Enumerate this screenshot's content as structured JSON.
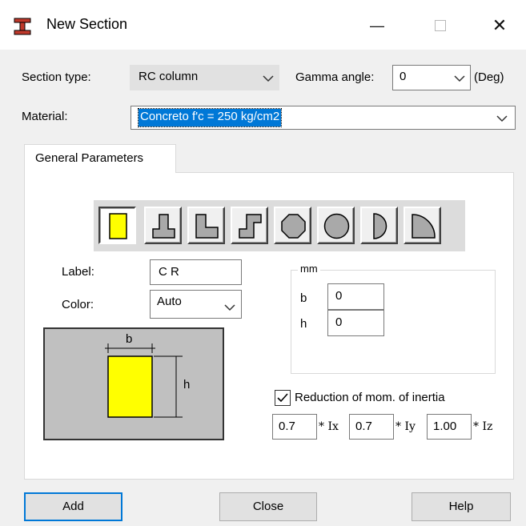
{
  "window": {
    "title": "New Section",
    "icon": "section-i-beam-icon",
    "minimize_glyph": "—",
    "close_glyph": "✕"
  },
  "section_type": {
    "label": "Section type:",
    "value": "RC column"
  },
  "gamma": {
    "label": "Gamma angle:",
    "value": "0",
    "unit": "(Deg)"
  },
  "material": {
    "label": "Material:",
    "value": "Concreto f'c = 250 kg/cm2"
  },
  "tabs": [
    {
      "label": "General Parameters"
    }
  ],
  "shapes": [
    {
      "icon": "rectangle-shape-icon",
      "selected": true
    },
    {
      "icon": "inverted-t-shape-icon",
      "selected": false
    },
    {
      "icon": "l-shape-icon",
      "selected": false
    },
    {
      "icon": "z-shape-icon",
      "selected": false
    },
    {
      "icon": "octagon-shape-icon",
      "selected": false
    },
    {
      "icon": "circle-shape-icon",
      "selected": false
    },
    {
      "icon": "half-circle-shape-icon",
      "selected": false
    },
    {
      "icon": "quarter-circle-shape-icon",
      "selected": false
    }
  ],
  "label_field": {
    "label": "Label:",
    "value": "C R"
  },
  "color_field": {
    "label": "Color:",
    "value": "Auto"
  },
  "dimensions": {
    "unit": "mm",
    "b_label": "b",
    "b_value": "0",
    "h_label": "h",
    "h_value": "0"
  },
  "preview": {
    "b_label": "b",
    "h_label": "h",
    "fill": "#ffff00"
  },
  "inertia": {
    "label": "Reduction of mom. of inertia",
    "checked": true,
    "ix_value": "0.7",
    "ix_label": "* Ix",
    "iy_value": "0.7",
    "iy_label": "* Iy",
    "iz_value": "1.00",
    "iz_label": "* Iz"
  },
  "buttons": {
    "add": "Add",
    "close": "Close",
    "help": "Help"
  },
  "colors": {
    "accent": "#0078d7",
    "dialog_bg": "#f0f0f0",
    "preview_bg": "#c0c0c0"
  }
}
